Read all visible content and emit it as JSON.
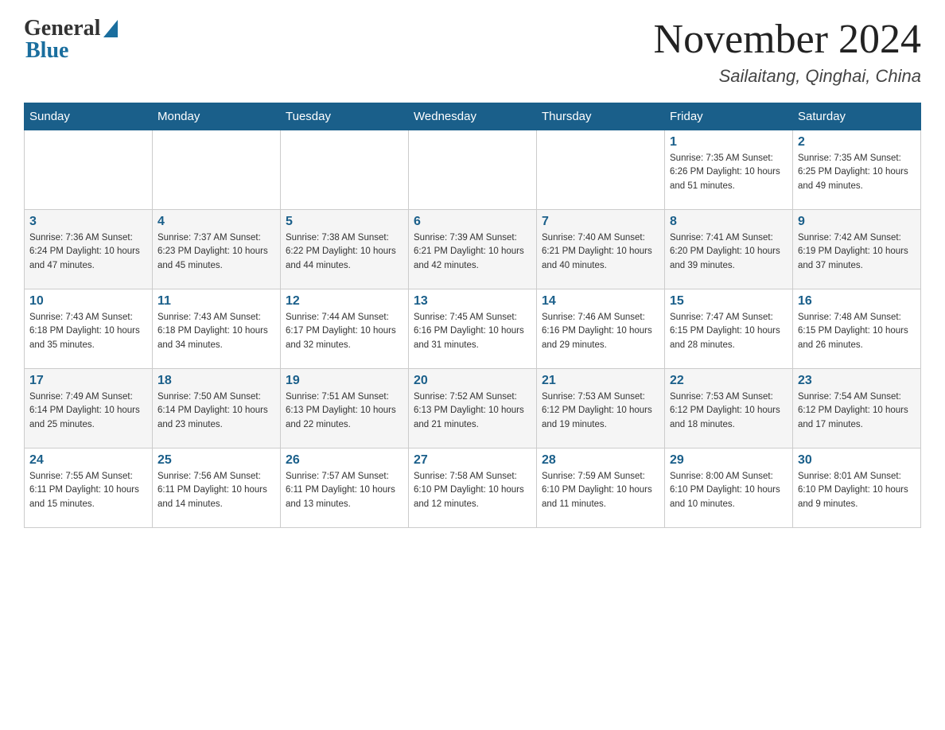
{
  "header": {
    "logo_general": "General",
    "logo_blue": "Blue",
    "month_title": "November 2024",
    "location": "Sailaitang, Qinghai, China"
  },
  "days_of_week": [
    "Sunday",
    "Monday",
    "Tuesday",
    "Wednesday",
    "Thursday",
    "Friday",
    "Saturday"
  ],
  "weeks": [
    [
      {
        "day": "",
        "info": ""
      },
      {
        "day": "",
        "info": ""
      },
      {
        "day": "",
        "info": ""
      },
      {
        "day": "",
        "info": ""
      },
      {
        "day": "",
        "info": ""
      },
      {
        "day": "1",
        "info": "Sunrise: 7:35 AM\nSunset: 6:26 PM\nDaylight: 10 hours and 51 minutes."
      },
      {
        "day": "2",
        "info": "Sunrise: 7:35 AM\nSunset: 6:25 PM\nDaylight: 10 hours and 49 minutes."
      }
    ],
    [
      {
        "day": "3",
        "info": "Sunrise: 7:36 AM\nSunset: 6:24 PM\nDaylight: 10 hours and 47 minutes."
      },
      {
        "day": "4",
        "info": "Sunrise: 7:37 AM\nSunset: 6:23 PM\nDaylight: 10 hours and 45 minutes."
      },
      {
        "day": "5",
        "info": "Sunrise: 7:38 AM\nSunset: 6:22 PM\nDaylight: 10 hours and 44 minutes."
      },
      {
        "day": "6",
        "info": "Sunrise: 7:39 AM\nSunset: 6:21 PM\nDaylight: 10 hours and 42 minutes."
      },
      {
        "day": "7",
        "info": "Sunrise: 7:40 AM\nSunset: 6:21 PM\nDaylight: 10 hours and 40 minutes."
      },
      {
        "day": "8",
        "info": "Sunrise: 7:41 AM\nSunset: 6:20 PM\nDaylight: 10 hours and 39 minutes."
      },
      {
        "day": "9",
        "info": "Sunrise: 7:42 AM\nSunset: 6:19 PM\nDaylight: 10 hours and 37 minutes."
      }
    ],
    [
      {
        "day": "10",
        "info": "Sunrise: 7:43 AM\nSunset: 6:18 PM\nDaylight: 10 hours and 35 minutes."
      },
      {
        "day": "11",
        "info": "Sunrise: 7:43 AM\nSunset: 6:18 PM\nDaylight: 10 hours and 34 minutes."
      },
      {
        "day": "12",
        "info": "Sunrise: 7:44 AM\nSunset: 6:17 PM\nDaylight: 10 hours and 32 minutes."
      },
      {
        "day": "13",
        "info": "Sunrise: 7:45 AM\nSunset: 6:16 PM\nDaylight: 10 hours and 31 minutes."
      },
      {
        "day": "14",
        "info": "Sunrise: 7:46 AM\nSunset: 6:16 PM\nDaylight: 10 hours and 29 minutes."
      },
      {
        "day": "15",
        "info": "Sunrise: 7:47 AM\nSunset: 6:15 PM\nDaylight: 10 hours and 28 minutes."
      },
      {
        "day": "16",
        "info": "Sunrise: 7:48 AM\nSunset: 6:15 PM\nDaylight: 10 hours and 26 minutes."
      }
    ],
    [
      {
        "day": "17",
        "info": "Sunrise: 7:49 AM\nSunset: 6:14 PM\nDaylight: 10 hours and 25 minutes."
      },
      {
        "day": "18",
        "info": "Sunrise: 7:50 AM\nSunset: 6:14 PM\nDaylight: 10 hours and 23 minutes."
      },
      {
        "day": "19",
        "info": "Sunrise: 7:51 AM\nSunset: 6:13 PM\nDaylight: 10 hours and 22 minutes."
      },
      {
        "day": "20",
        "info": "Sunrise: 7:52 AM\nSunset: 6:13 PM\nDaylight: 10 hours and 21 minutes."
      },
      {
        "day": "21",
        "info": "Sunrise: 7:53 AM\nSunset: 6:12 PM\nDaylight: 10 hours and 19 minutes."
      },
      {
        "day": "22",
        "info": "Sunrise: 7:53 AM\nSunset: 6:12 PM\nDaylight: 10 hours and 18 minutes."
      },
      {
        "day": "23",
        "info": "Sunrise: 7:54 AM\nSunset: 6:12 PM\nDaylight: 10 hours and 17 minutes."
      }
    ],
    [
      {
        "day": "24",
        "info": "Sunrise: 7:55 AM\nSunset: 6:11 PM\nDaylight: 10 hours and 15 minutes."
      },
      {
        "day": "25",
        "info": "Sunrise: 7:56 AM\nSunset: 6:11 PM\nDaylight: 10 hours and 14 minutes."
      },
      {
        "day": "26",
        "info": "Sunrise: 7:57 AM\nSunset: 6:11 PM\nDaylight: 10 hours and 13 minutes."
      },
      {
        "day": "27",
        "info": "Sunrise: 7:58 AM\nSunset: 6:10 PM\nDaylight: 10 hours and 12 minutes."
      },
      {
        "day": "28",
        "info": "Sunrise: 7:59 AM\nSunset: 6:10 PM\nDaylight: 10 hours and 11 minutes."
      },
      {
        "day": "29",
        "info": "Sunrise: 8:00 AM\nSunset: 6:10 PM\nDaylight: 10 hours and 10 minutes."
      },
      {
        "day": "30",
        "info": "Sunrise: 8:01 AM\nSunset: 6:10 PM\nDaylight: 10 hours and 9 minutes."
      }
    ]
  ]
}
